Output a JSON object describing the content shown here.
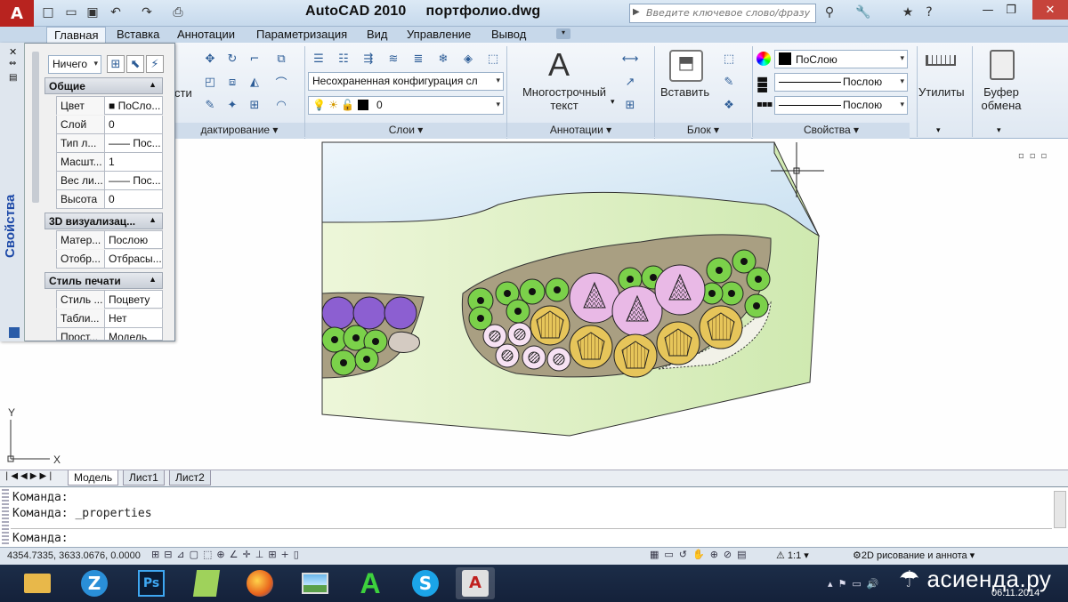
{
  "app": {
    "title": "AutoCAD 2010",
    "file": "портфолио.dwg",
    "search_placeholder": "Введите ключевое слово/фразу"
  },
  "quick_access": [
    "new-icon",
    "open-icon",
    "save-icon",
    "undo-icon",
    "redo-icon",
    "plot-icon"
  ],
  "ribbon_tabs": [
    "Главная",
    "Вставка",
    "Аннотации",
    "Параметризация",
    "Вид",
    "Управление",
    "Вывод"
  ],
  "ribbon": {
    "edit_panel_label": "дактирование",
    "edit_cut_text": "сти",
    "layers_panel_label": "Слои",
    "layer_state": "Несохраненная конфигурация сл",
    "layer_current": "0",
    "annot_panel_label": "Аннотации",
    "mtext_label_1": "Многострочный",
    "mtext_label_2": "текст",
    "block_panel_label": "Блок",
    "insert_label": "Вставить",
    "props_panel_label": "Свойства",
    "color_value": "ПоСлою",
    "linetype_value": "Послою",
    "lineweight_value": "Послою",
    "utilities_label": "Утилиты",
    "clipboard_label_1": "Буфер",
    "clipboard_label_2": "обмена"
  },
  "properties_palette": {
    "title": "Свойства",
    "selection": "Ничего",
    "sections": [
      {
        "name": "Общие",
        "rows": [
          {
            "key": "Цвет",
            "value": "■ ПоСло..."
          },
          {
            "key": "Слой",
            "value": "0"
          },
          {
            "key": "Тип л...",
            "value": "—— Пос..."
          },
          {
            "key": "Масшт...",
            "value": "1"
          },
          {
            "key": "Вес ли...",
            "value": "—— Пос..."
          },
          {
            "key": "Высота",
            "value": "0"
          }
        ]
      },
      {
        "name": "3D визуализац...",
        "rows": [
          {
            "key": "Матер...",
            "value": "Послою"
          },
          {
            "key": "Отобр...",
            "value": "Отбрасы..."
          }
        ]
      },
      {
        "name": "Стиль печати",
        "rows": [
          {
            "key": "Стиль ...",
            "value": "Поцвету"
          },
          {
            "key": "Табли...",
            "value": "Нет"
          },
          {
            "key": "Прост...",
            "value": "Модель"
          }
        ]
      }
    ]
  },
  "ucs": {
    "y": "Y",
    "x": "X"
  },
  "layout_tabs": [
    "Модель",
    "Лист1",
    "Лист2"
  ],
  "command": {
    "history": [
      "Команда:",
      "Команда:  _properties"
    ],
    "prompt": "Команда:"
  },
  "status": {
    "coords": "4354.7335, 3633.0676, 0.0000",
    "scale": "1:1",
    "workspace": "2D рисование и аннота"
  },
  "taskbar": {
    "date": "06.11.2014",
    "watermark": "асиенда.ру"
  },
  "colors": {
    "water": "#dbeaf5",
    "lawn": "#e3f0cf",
    "soil": "#a99f82",
    "shrub_green": "#7bd14a",
    "shrub_purple": "#8c5fd1",
    "tree_pink": "#e9b9e6",
    "tree_yellow": "#e6c55a"
  }
}
